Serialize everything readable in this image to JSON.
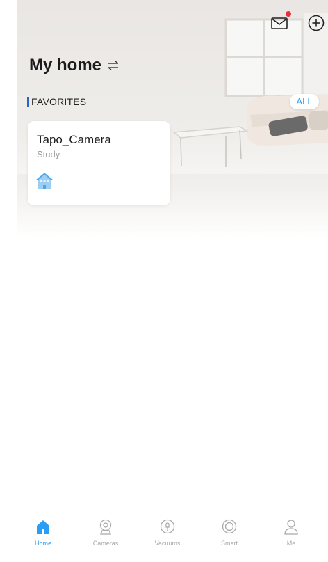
{
  "header": {
    "title": "My home",
    "icons": {
      "mail": "mail-icon",
      "add": "add-circle-icon",
      "switch": "swap-icon"
    },
    "notification_dot_color": "#e8303a"
  },
  "favorites": {
    "label": "FAVORITES",
    "all_label": "ALL",
    "accent_color": "#2a62c9"
  },
  "devices": [
    {
      "name": "Tapo_Camera",
      "room": "Study",
      "icon": "house-icon"
    }
  ],
  "bottom_nav": {
    "active_color": "#2a9df4",
    "items": [
      {
        "label": "Home",
        "icon": "home-icon",
        "active": true
      },
      {
        "label": "Cameras",
        "icon": "camera-icon",
        "active": false
      },
      {
        "label": "Vacuums",
        "icon": "vacuum-icon",
        "active": false
      },
      {
        "label": "Smart",
        "icon": "smart-icon",
        "active": false
      },
      {
        "label": "Me",
        "icon": "person-icon",
        "active": false
      }
    ]
  }
}
